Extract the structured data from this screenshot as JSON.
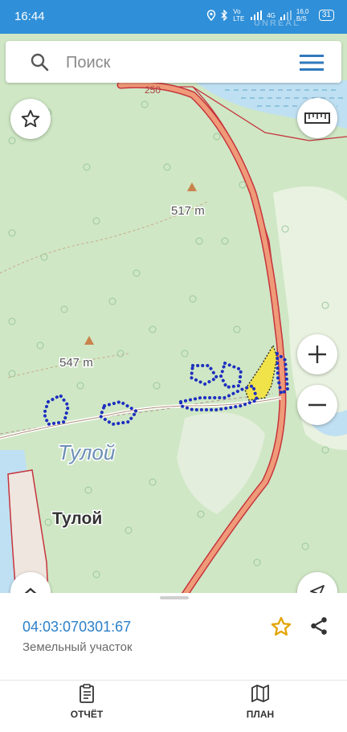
{
  "status_bar": {
    "time": "16:44",
    "network_1": "Vo LTE",
    "network_2": "4G",
    "speed": "16,0 B/S",
    "battery": "31",
    "watermark": "UNREAL"
  },
  "search": {
    "placeholder": "Поиск"
  },
  "map": {
    "labels": {
      "peak_1": "517 m",
      "peak_2": "547 m",
      "village_italic": "Тулой",
      "village_bold": "Тулой",
      "road_number": "250"
    },
    "colors": {
      "forest": "#cfe7c5",
      "road": "#e88f6e",
      "boundary": "#c6343d",
      "parcel_dots": "#1d2fbf",
      "highlight": "#f0e34a",
      "water": "#bfe0f2"
    }
  },
  "controls": {
    "favorite_icon": "star-outline-icon",
    "ruler_icon": "ruler-icon",
    "zoom_in_icon": "plus-icon",
    "zoom_out_icon": "minus-icon",
    "expand_icon": "chevron-up-icon",
    "locate_icon": "locate-arrow-icon"
  },
  "parcel": {
    "cadastral_number": "04:03:070301:67",
    "type": "Земельный участок",
    "favorite_color": "#e2a400"
  },
  "bottom_nav": [
    {
      "label": "ОТЧЁТ",
      "icon": "report-icon"
    },
    {
      "label": "ПЛАН",
      "icon": "map-plan-icon"
    }
  ]
}
